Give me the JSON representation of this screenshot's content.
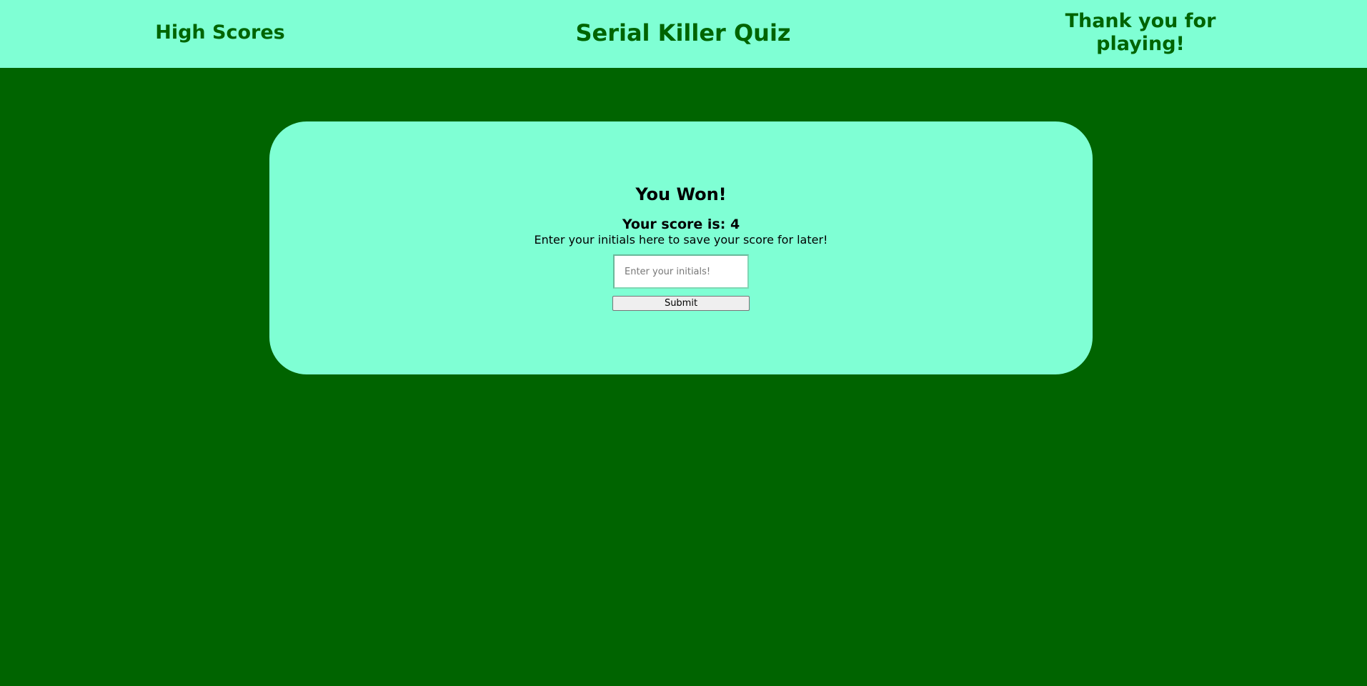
{
  "header": {
    "high_scores_link": "High Scores",
    "title": "Serial Killer Quiz",
    "thanks": "Thank you for playing!"
  },
  "result": {
    "heading": "You Won!",
    "score_label": "Your score is: ",
    "score": "4",
    "instructions": "Enter your initials here to save your score for later!",
    "initials_value": "",
    "initials_placeholder": "Enter your initials!",
    "submit_label": "Submit"
  },
  "colors": {
    "background": "#006400",
    "panel": "#7fffd4",
    "header_text": "#006400"
  }
}
